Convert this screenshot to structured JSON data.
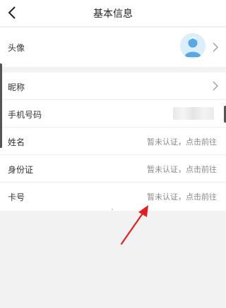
{
  "nav": {
    "title": "基本信息"
  },
  "avatar_row": {
    "label": "头像"
  },
  "rows": [
    {
      "label": "昵称",
      "value": ""
    },
    {
      "label": "手机号码",
      "value": ""
    },
    {
      "label": "姓名",
      "value": "暂未认证，点击前往"
    },
    {
      "label": "身份证",
      "value": "暂未认证，点击前往"
    },
    {
      "label": "卡号",
      "value": "暂未认证，点击前往"
    }
  ],
  "colors": {
    "background": "#f2f2f2",
    "card": "#ffffff",
    "value_text": "#8a8a8a",
    "arrow": "#e02020",
    "avatar_bg": "#dbeefb",
    "avatar_fg": "#5aa7e6"
  },
  "icons": {
    "back": "chevron-left-icon",
    "chevron": "chevron-right-icon",
    "avatar": "user-avatar-icon",
    "annotation": "red-arrow"
  }
}
